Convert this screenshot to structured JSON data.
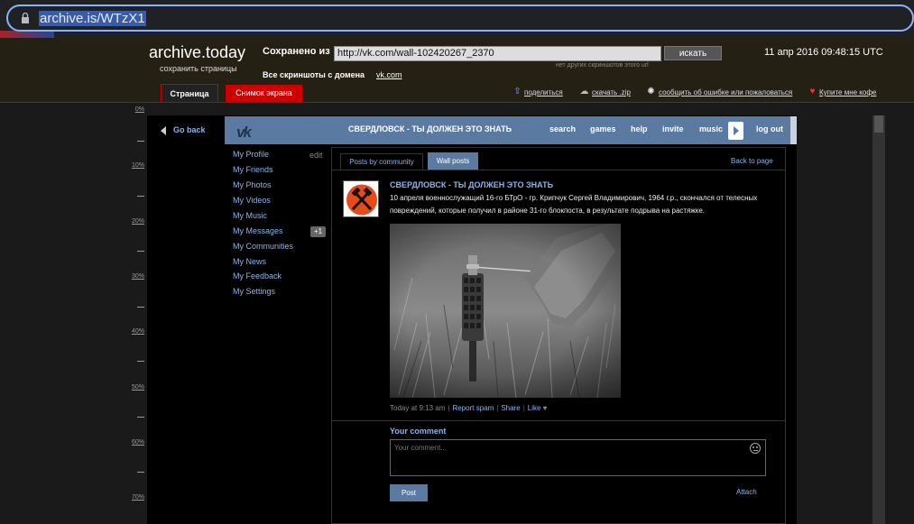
{
  "browser": {
    "url": "archive.is/WTzX1"
  },
  "archive": {
    "title": "archive.today",
    "subtitle": "сохранить страницы",
    "saved_from_label": "Сохранено из",
    "saved_url": "http://vk.com/wall-102420267_2370",
    "search_button": "искать",
    "no_other": "нет других скриншотов этого url",
    "all_screenshots_label": "Все скриншоты  с домена",
    "domain": "vk.com",
    "date": "11 апр 2016 09:48:15 UTC",
    "tab_page": "Страница",
    "tab_screenshot": "Снимок экрана",
    "share": "поделиться",
    "download": "скачать .zip",
    "report": "сообщить об ошибке или пожаловаться",
    "coffee": "Купите мне кофе",
    "accent": "#cc0000"
  },
  "ruler": {
    "labels": [
      "0%",
      "10%",
      "20%",
      "30%",
      "40%",
      "50%",
      "60%",
      "70%"
    ]
  },
  "vk": {
    "logo": "vk",
    "brand_color": "#5b7aa2",
    "group_title": "СВЕРДЛОВСК - ТЫ ДОЛЖЕН ЭТО ЗНАТЬ",
    "nav": [
      "search",
      "games",
      "help",
      "invite",
      "music",
      "log out"
    ],
    "go_back": "Go back",
    "menu_edit": "edit",
    "menu": [
      "My Profile",
      "My Friends",
      "My Photos",
      "My Videos",
      "My Music",
      "My Messages",
      "My Communities",
      "My News",
      "My Feedback",
      "My Settings"
    ],
    "messages_badge": "+1",
    "tabs": {
      "community": "Posts by community",
      "wall": "Wall posts"
    },
    "back_to_page": "Back to page",
    "post": {
      "author": "СВЕРДЛОВСК - ТЫ ДОЛЖЕН ЭТО ЗНАТЬ",
      "text": "10 апреля военнослужащий 16-го БТрО - гр. Крипчук Сергей Владимирович, 1964 г.р., скончался от телесных повреждений, которые получил в районе 31-го блокпоста, в результате подрыва на растяжке.",
      "time": "Today at 9:13 am",
      "report_spam": "Report spam",
      "share": "Share",
      "like": "Like"
    },
    "comment": {
      "heading": "Your comment",
      "placeholder": "Your comment..",
      "post_button": "Post",
      "attach": "Attach"
    }
  }
}
